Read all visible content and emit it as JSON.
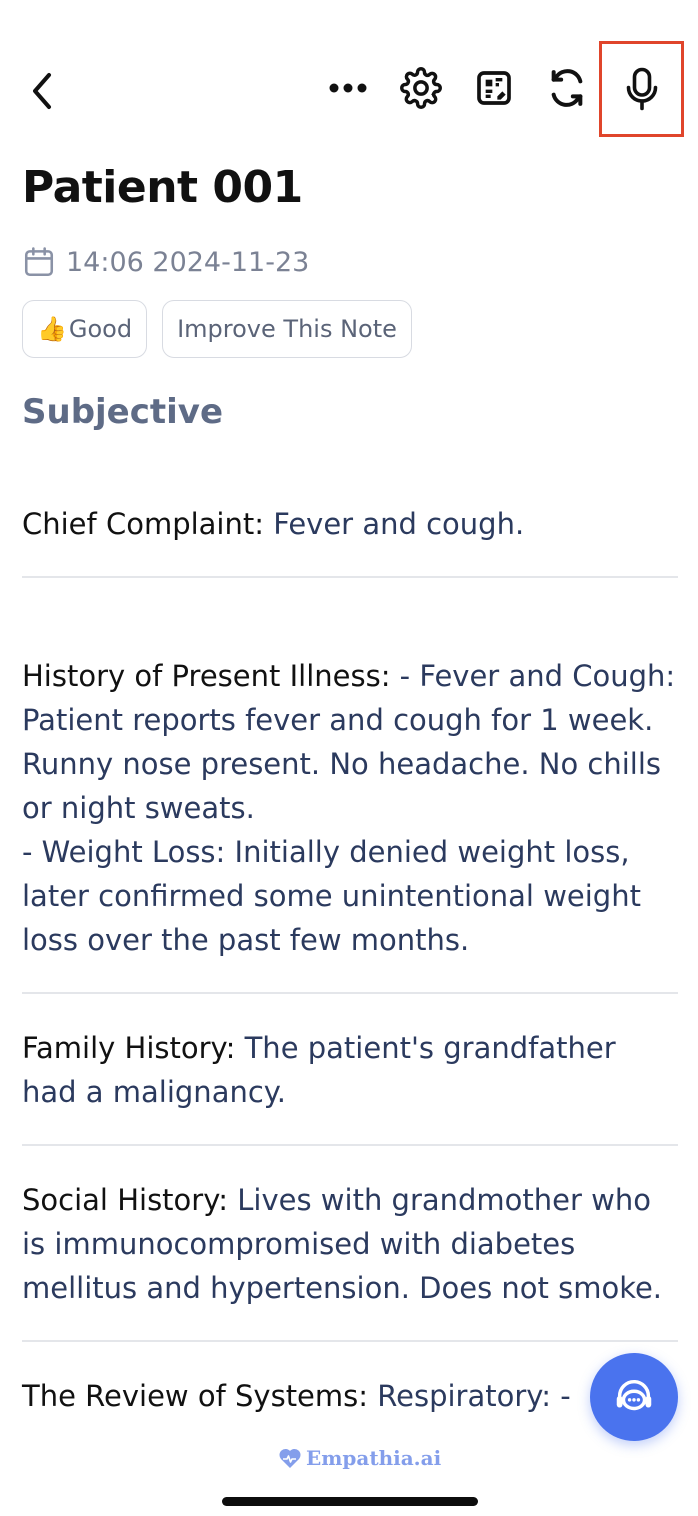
{
  "header": {
    "title": "Patient 001",
    "datetime": "14:06 2024-11-23"
  },
  "toolbar": {
    "icons": [
      "back-icon",
      "more-icon",
      "gear-icon",
      "qr-edit-icon",
      "sync-icon",
      "microphone-icon"
    ]
  },
  "chips": {
    "good_emoji": "👍",
    "good_label": "Good",
    "improve_label": "Improve This Note"
  },
  "section": {
    "title": "Subjective"
  },
  "notes": [
    {
      "label": "Chief Complaint:",
      "text": " Fever and cough."
    },
    {
      "label": "History of Present Illness:",
      "text": " - Fever and Cough: Patient reports fever and cough for 1 week. Runny nose present. No headache. No chills or night sweats.\n- Weight Loss: Initially denied weight loss, later confirmed some unintentional weight loss over the past few months."
    },
    {
      "label": "Family History:",
      "text": " The patient's grandfather had a malignancy."
    },
    {
      "label": "Social History:",
      "text": " Lives with grandmother who is immunocompromised with diabetes mellitus and hypertension. Does not smoke."
    },
    {
      "label": "The Review of Systems:",
      "text": " Respiratory: -"
    }
  ],
  "brand": {
    "name": "Empathia.ai"
  },
  "colors": {
    "accent": "#4a73ee",
    "highlight_border": "#e0452b",
    "body_text": "#2b3a5e",
    "muted": "#7b8294"
  }
}
